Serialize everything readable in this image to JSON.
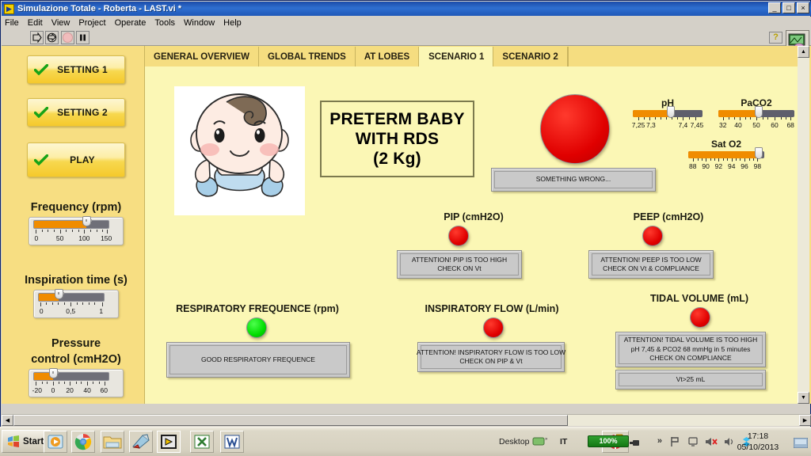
{
  "window": {
    "title": "Simulazione Totale - Roberta - LAST.vi *",
    "icon": "labview-vi-icon",
    "buttons": {
      "minimize": "_",
      "maximize": "□",
      "close": "×"
    }
  },
  "menubar": {
    "items": [
      "File",
      "Edit",
      "View",
      "Project",
      "Operate",
      "Tools",
      "Window",
      "Help"
    ]
  },
  "toolbar": {
    "run": "run-arrow-icon",
    "run_continuously": "run-continuously-icon",
    "abort": "abort-execution-icon",
    "pause": "pause-icon",
    "help": "?",
    "vi_icon": "labview-front-panel-icon"
  },
  "tabs": [
    {
      "label": "GENERAL OVERVIEW",
      "active": false
    },
    {
      "label": "GLOBAL TRENDS",
      "active": false
    },
    {
      "label": "AT LOBES",
      "active": false
    },
    {
      "label": "SCENARIO 1",
      "active": true
    },
    {
      "label": "SCENARIO 2",
      "active": false
    }
  ],
  "sidebar": {
    "buttons": [
      {
        "label": "SETTING 1",
        "icon": "green-check-icon"
      },
      {
        "label": "SETTING 2",
        "icon": "green-check-icon"
      },
      {
        "label": "PLAY",
        "icon": "green-check-icon"
      }
    ],
    "sliders": [
      {
        "caption": "Frequency (rpm)",
        "ticks": [
          "0",
          "50",
          "100",
          "150"
        ],
        "min": 0,
        "max": 150,
        "value": 105,
        "fill_pct": 70
      },
      {
        "caption": "Inspiration time (s)",
        "ticks": [
          "0",
          "0,5",
          "1"
        ],
        "min": 0,
        "max": 1,
        "value": 0.3,
        "fill_pct": 30
      },
      {
        "caption_line1": "Pressure",
        "caption_line2": "control (cmH2O)",
        "ticks": [
          "-20",
          "0",
          "20",
          "40",
          "60"
        ],
        "min": -20,
        "max": 60,
        "value": 0,
        "fill_pct": 26
      }
    ]
  },
  "main": {
    "baby_image": "cartoon-preterm-baby-illustration",
    "diagnosis": {
      "line1": "PRETERM BABY",
      "line2": "WITH RDS",
      "line3": "(2 Kg)"
    },
    "global_alarm": {
      "led": "red",
      "message": "SOMETHING WRONG..."
    },
    "blood_gas_sliders": [
      {
        "caption": "pH",
        "ticks": [
          "7,25",
          "7,3",
          "7,4",
          "7,45"
        ],
        "tick_pos_pct": [
          8,
          24,
          72,
          90
        ],
        "value": 7.35,
        "fill_pct": 55
      },
      {
        "caption": "PaCO2",
        "ticks": [
          "32",
          "40",
          "50",
          "60",
          "68"
        ],
        "tick_pos_pct": [
          6,
          26,
          50,
          74,
          95
        ],
        "value": 50,
        "fill_pct": 53
      },
      {
        "caption": "Sat O2",
        "ticks": [
          "88",
          "90",
          "92",
          "94",
          "96",
          "98"
        ],
        "tick_pos_pct": [
          6,
          23,
          40,
          57,
          74,
          91
        ],
        "value": 98,
        "fill_pct": 93
      }
    ],
    "indicators": [
      {
        "caption": "PIP (cmH2O)",
        "led": "red",
        "messages": [
          "ATTENTION! PIP IS TOO HIGH",
          "CHECK ON Vt"
        ]
      },
      {
        "caption": "PEEP (cmH2O)",
        "led": "red",
        "messages": [
          "ATTENTION! PEEP IS TOO LOW",
          "CHECK ON Vt & COMPLIANCE"
        ]
      },
      {
        "caption": "RESPIRATORY FREQUENCE (rpm)",
        "led": "green",
        "messages": [
          "GOOD RESPIRATORY FREQUENCE"
        ]
      },
      {
        "caption": "INSPIRATORY FLOW (L/min)",
        "led": "red",
        "messages": [
          "ATTENTION! INSPIRATORY FLOW IS TOO LOW",
          "CHECK ON PIP & Vt"
        ]
      },
      {
        "caption": "TIDAL VOLUME (mL)",
        "led": "red",
        "messages": [
          "ATTENTION! TIDAL VOLUME IS TOO HIGH",
          "pH 7,45 & PCO2 68 mmHg in 5 minutes",
          "CHECK ON COMPLIANCE"
        ],
        "secondary_message": "Vt>25 mL"
      }
    ]
  },
  "taskbar": {
    "start_label": "Start",
    "quick_launch": [
      "media-player-icon",
      "chrome-icon",
      "file-explorer-icon",
      "paint-icon",
      "labview-icon",
      "excel-icon",
      "word-icon"
    ],
    "desktop_label": "Desktop",
    "language": "IT",
    "battery": "100%",
    "tray_icons": [
      "chevron-up-icon",
      "flag-icon",
      "network-icon",
      "volume-mute-icon",
      "volume-icon",
      "dropbox-icon"
    ],
    "time": "17:18",
    "date": "05/10/2013"
  }
}
